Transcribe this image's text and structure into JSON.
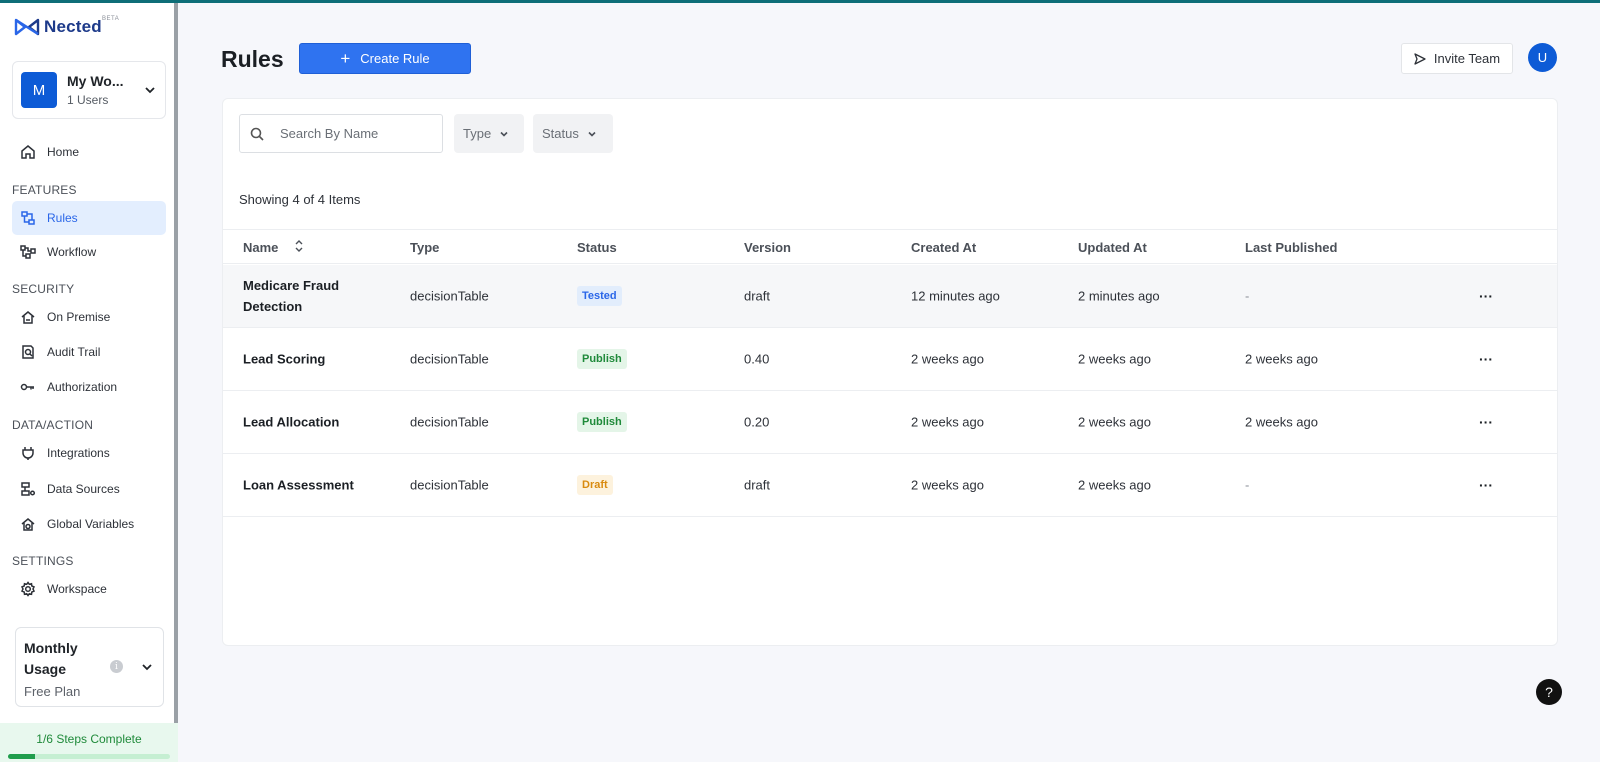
{
  "brand": {
    "name": "Nected",
    "beta": "BETA"
  },
  "workspace": {
    "initial": "M",
    "name": "My Wo...",
    "users": "1 Users"
  },
  "sidebar": {
    "home": "Home",
    "sections": {
      "features": "FEATURES",
      "security": "SECURITY",
      "data_action": "DATA/ACTION",
      "settings": "SETTINGS"
    },
    "items": {
      "rules": "Rules",
      "workflow": "Workflow",
      "on_premise": "On Premise",
      "audit_trail": "Audit Trail",
      "authorization": "Authorization",
      "integrations": "Integrations",
      "data_sources": "Data Sources",
      "global_variables": "Global Variables",
      "workspace": "Workspace"
    },
    "active_item": "rules"
  },
  "usage": {
    "title": "Monthly Usage",
    "plan": "Free Plan",
    "info": "i"
  },
  "steps": {
    "text": "1/6 Steps Complete",
    "progress": 0.167
  },
  "header": {
    "title": "Rules",
    "create_label": "Create Rule",
    "invite_label": "Invite Team",
    "user_initial": "U"
  },
  "filters": {
    "search_placeholder": "Search By Name",
    "type_label": "Type",
    "status_label": "Status"
  },
  "count_text": "Showing 4 of 4 Items",
  "table": {
    "columns": [
      "Name",
      "Type",
      "Status",
      "Version",
      "Created At",
      "Updated At",
      "Last Published"
    ],
    "rows": [
      {
        "name": "Medicare Fraud Detection",
        "type": "decisionTable",
        "status": "Tested",
        "version": "draft",
        "created": "12 minutes ago",
        "updated": "2 minutes ago",
        "published": "-"
      },
      {
        "name": "Lead Scoring",
        "type": "decisionTable",
        "status": "Publish",
        "version": "0.40",
        "created": "2 weeks ago",
        "updated": "2 weeks ago",
        "published": "2 weeks ago"
      },
      {
        "name": "Lead Allocation",
        "type": "decisionTable",
        "status": "Publish",
        "version": "0.20",
        "created": "2 weeks ago",
        "updated": "2 weeks ago",
        "published": "2 weeks ago"
      },
      {
        "name": "Loan Assessment",
        "type": "decisionTable",
        "status": "Draft",
        "version": "draft",
        "created": "2 weeks ago",
        "updated": "2 weeks ago",
        "published": "-"
      }
    ],
    "more_label": "···"
  },
  "help": "?",
  "colors": {
    "accent": "#2f73f0",
    "brand": "#0d5bd6",
    "topbar": "#0e6e78",
    "success": "#1f8a3a",
    "warning": "#d98b10"
  }
}
